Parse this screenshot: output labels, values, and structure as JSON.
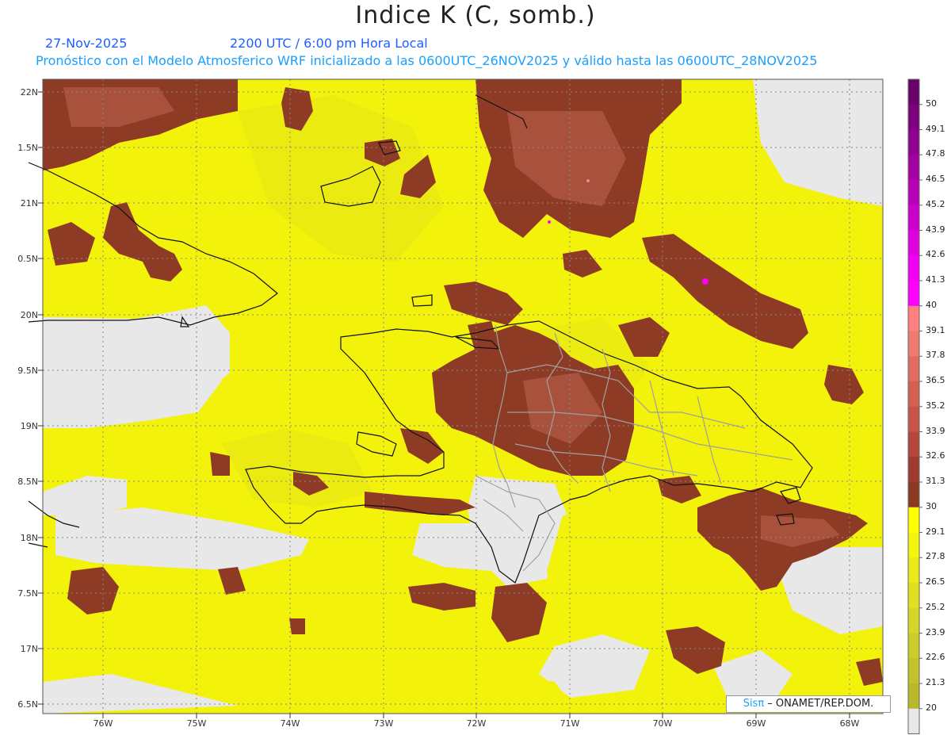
{
  "title": "Indice K (C, somb.)",
  "date": "27-Nov-2025",
  "valid_time": "2200 UTC / 6:00 pm Hora Local",
  "description": "Pronóstico con el Modelo Atmosferico WRF inicializado a las 0600UTC_26NOV2025 y válido hasta las  0600UTC_28NOV2025",
  "credit": {
    "sis": "Sisπ",
    "org": " – ONAMET/REP.DOM."
  },
  "lat_labels": [
    "22N",
    "1.5N",
    "21N",
    "0.5N",
    "20N",
    "9.5N",
    "19N",
    "8.5N",
    "18N",
    "7.5N",
    "17N",
    "6.5N"
  ],
  "lon_labels": [
    "76W",
    "75W",
    "74W",
    "73W",
    "72W",
    "71W",
    "70W",
    "69W",
    "68W"
  ],
  "colorbar": {
    "labels": [
      "50",
      "49.1",
      "47.8",
      "46.5",
      "45.2",
      "43.9",
      "42.6",
      "41.3",
      "40",
      "39.1",
      "37.8",
      "36.5",
      "35.2",
      "33.9",
      "32.6",
      "31.3",
      "30",
      "29.1",
      "27.8",
      "26.5",
      "25.2",
      "23.9",
      "22.6",
      "21.3",
      "20"
    ],
    "colors": [
      "#6a006a",
      "#7d007d",
      "#8f008f",
      "#a300a3",
      "#b800b8",
      "#cc00cc",
      "#e000e0",
      "#f200f2",
      "#ff00ff",
      "#ff8080",
      "#ef7a70",
      "#e26b60",
      "#d46052",
      "#c65548",
      "#b4473c",
      "#9f3a2e",
      "#8b3a22",
      "#ffff00",
      "#f4f40e",
      "#eaea18",
      "#e0e020",
      "#d6d626",
      "#cccc2a",
      "#c2c22c",
      "#b8b82a",
      "#e8e8e8"
    ]
  },
  "colors": {
    "background_sea": "#e8e8e8",
    "field_base": "#f2f20a",
    "field_dark": "#e0dd15",
    "high_k": "#8e3b26",
    "high_k_light": "#a24b3a",
    "peak": "#ff00ff",
    "coastline": "#111111",
    "border_provinces": "#a0a0a0",
    "grid": "#888888"
  }
}
